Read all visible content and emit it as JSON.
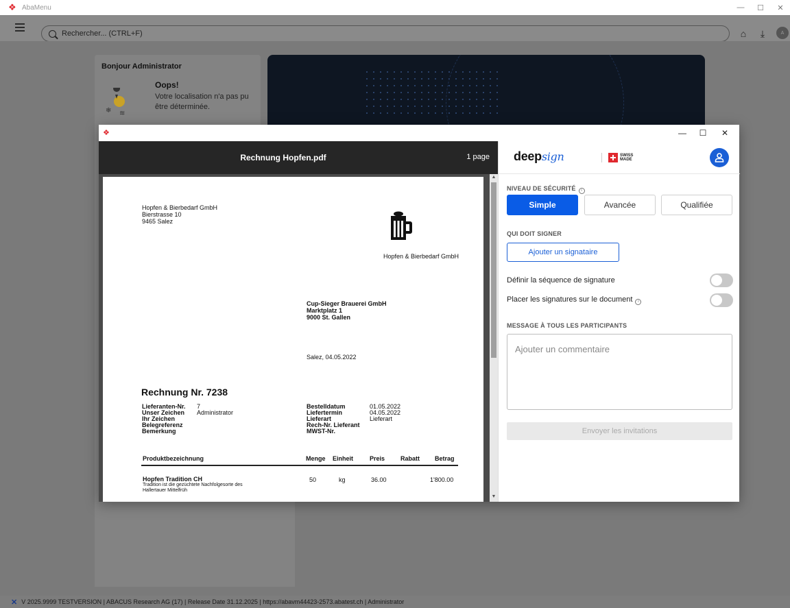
{
  "app": {
    "title": "AbaMenu",
    "search_placeholder": "Rechercher... (CTRL+F)",
    "avatar_initials": "A"
  },
  "dashboard": {
    "greeting": "Bonjour Administrator",
    "weather_title": "Oops!",
    "weather_text": "Votre localisation n'a pas pu être déterminée."
  },
  "status_bar": {
    "text": "V 2025.9999 TESTVERSION | ABACUS Research AG (17) | Release Date 31.12.2025 | https://abavm44423-2573.abatest.ch | Administrator"
  },
  "viewer": {
    "file_name": "Rechnung Hopfen.pdf",
    "page_count": "1 page"
  },
  "document": {
    "sender_name": "Hopfen & Bierbedarf GmbH",
    "sender_street": "Bierstrasse 10",
    "sender_city": "9465 Salez",
    "logo_caption": "Hopfen & Bierbedarf GmbH",
    "recipient_name": "Cup-Sieger Brauerei GmbH",
    "recipient_street": "Marktplatz 1",
    "recipient_city": "9000 St. Gallen",
    "place_date": "Salez, 04.05.2022",
    "invoice_title": "Rechnung Nr. 7238",
    "left_fields": [
      {
        "label": "Lieferanten-Nr.",
        "value": "7"
      },
      {
        "label": "Unser Zeichen",
        "value": "Administrator"
      },
      {
        "label": "Ihr Zeichen",
        "value": ""
      },
      {
        "label": "Belegreferenz",
        "value": ""
      },
      {
        "label": "Bemerkung",
        "value": ""
      }
    ],
    "right_fields": [
      {
        "label": "Bestelldatum",
        "value": "01.05.2022"
      },
      {
        "label": "Liefertermin",
        "value": "04.05.2022"
      },
      {
        "label": "Lieferart",
        "value": "Lieferart"
      },
      {
        "label": "Rech-Nr. Lieferant",
        "value": ""
      },
      {
        "label": "MWST-Nr.",
        "value": ""
      }
    ],
    "table_headers": {
      "product": "Produktbezeichnung",
      "qty": "Menge",
      "unit": "Einheit",
      "price": "Preis",
      "discount": "Rabatt",
      "amount": "Betrag"
    },
    "rows": [
      {
        "product": "Hopfen Tradition CH",
        "desc1": "Tradition ist die gezüchtete Nachfolgesorte des",
        "desc2": "Hallertauer Mittelfrüh",
        "qty": "50",
        "unit": "kg",
        "price": "36.00",
        "discount": "",
        "amount": "1'800.00"
      }
    ]
  },
  "signing": {
    "brand_text": "deep",
    "brand_script": "sign",
    "swiss_line1": "SWISS",
    "swiss_line2": "MADE",
    "security_label": "NIVEAU DE SÉCURITÉ",
    "levels": [
      "Simple",
      "Avancée",
      "Qualifiée"
    ],
    "active_level": "Simple",
    "who_signs_label": "QUI DOIT SIGNER",
    "add_signer": "Ajouter un signataire",
    "sequence_label": "Définir la séquence de signature",
    "sequence_on": false,
    "place_label": "Placer les signatures sur le document",
    "place_on": false,
    "message_label": "MESSAGE À TOUS LES PARTICIPANTS",
    "message_placeholder": "Ajouter un commentaire",
    "send_button": "Envoyer les invitations",
    "accent_color": "#0a5ce6"
  }
}
